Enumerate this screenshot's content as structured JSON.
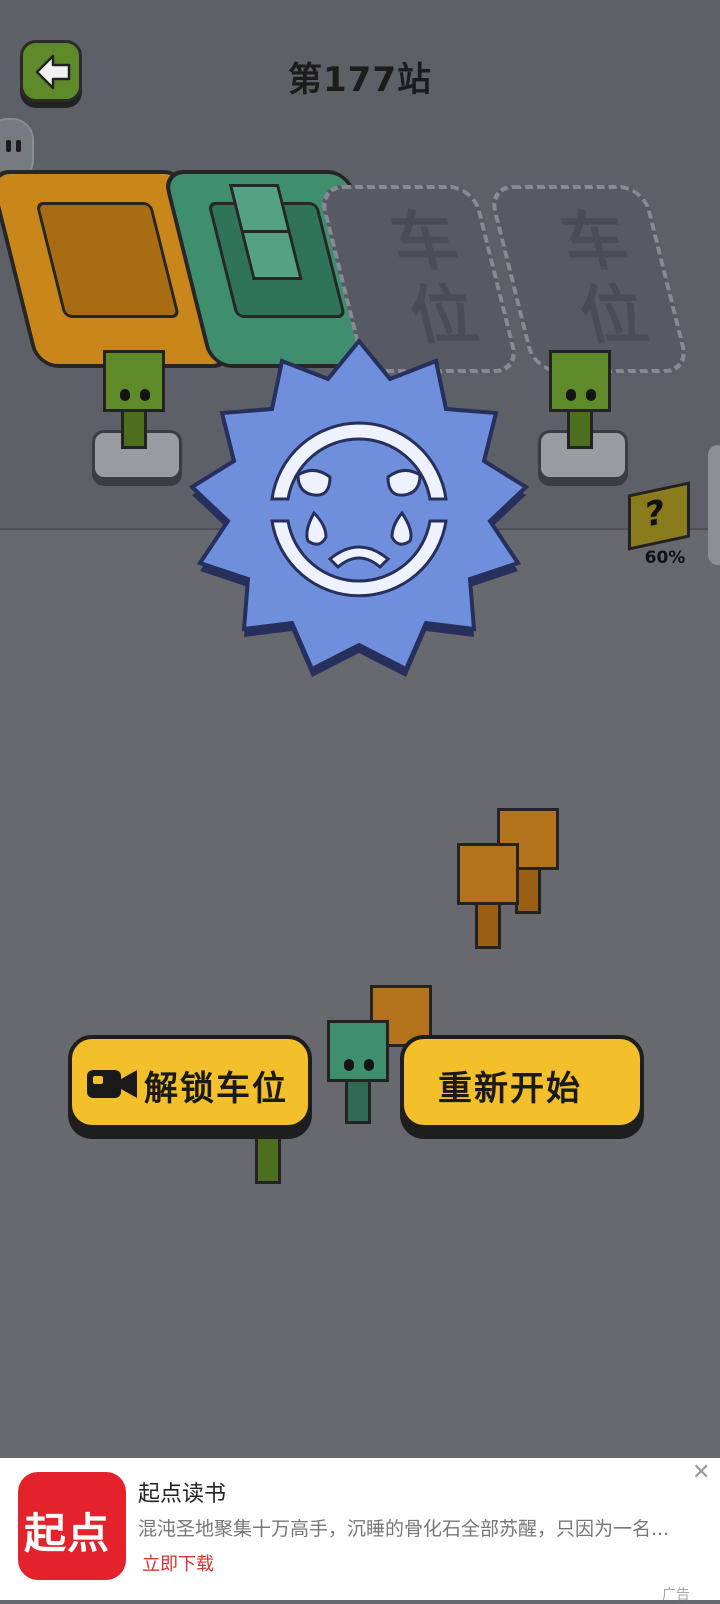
{
  "header": {
    "level_title": "第177站"
  },
  "parking": {
    "empty_slot_label": "车位"
  },
  "mystery": {
    "percent": "60%",
    "symbol": "?"
  },
  "actions": {
    "unlock_label": "解锁车位",
    "restart_label": "重新开始"
  },
  "ad": {
    "logo_text": "起点",
    "title": "起点读书",
    "description": "混沌圣地聚集十万高手，沉睡的骨化石全部苏醒，只因为一名...",
    "cta": "立即下载",
    "close": "✕",
    "mark": "广告"
  },
  "colors": {
    "unlock_button": "#f3bf2b",
    "restart_button": "#f3bf2b",
    "fail_badge": "#6f8edb",
    "orange_car": "#c9861a",
    "green_car": "#3f8f6f",
    "ad_logo": "#e3222c"
  }
}
